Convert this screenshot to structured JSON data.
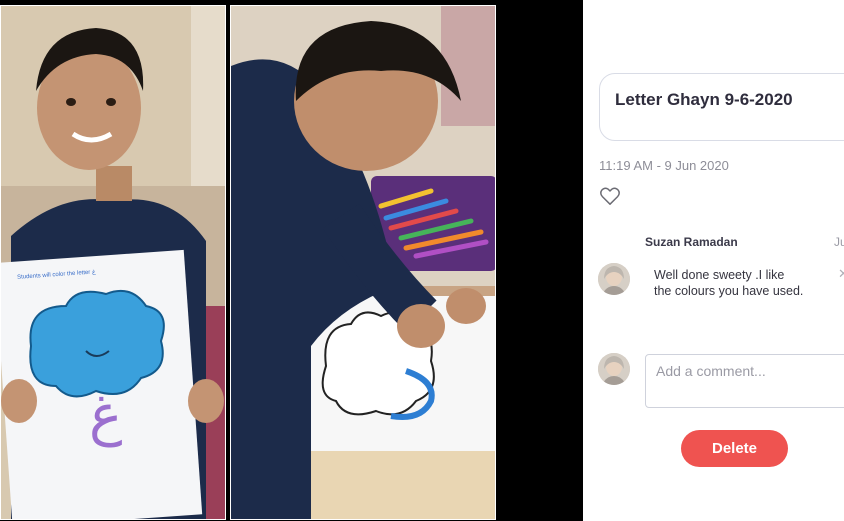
{
  "photos": {
    "left_sheet_caption": "Students will color the letter غ",
    "arabic_letter": "غ"
  },
  "post": {
    "title": "Letter Ghayn 9-6-2020",
    "timestamp": "11:19 AM - 9 Jun 2020"
  },
  "comments": [
    {
      "author": "Suzan Ramadan",
      "date_fragment": "Ju",
      "text": "Well done sweety  .I like the colours you have used."
    }
  ],
  "comment_input": {
    "placeholder": "Add a comment..."
  },
  "actions": {
    "delete_label": "Delete"
  },
  "colors": {
    "delete_button": "#ef5350",
    "title_text": "#2f2d3d",
    "muted_text": "#8e8e98",
    "cloud_blue": "#3aa0dc",
    "letter_purple": "#9b6fcf"
  },
  "icons": {
    "like": "heart-outline-icon",
    "close": "close-icon"
  }
}
